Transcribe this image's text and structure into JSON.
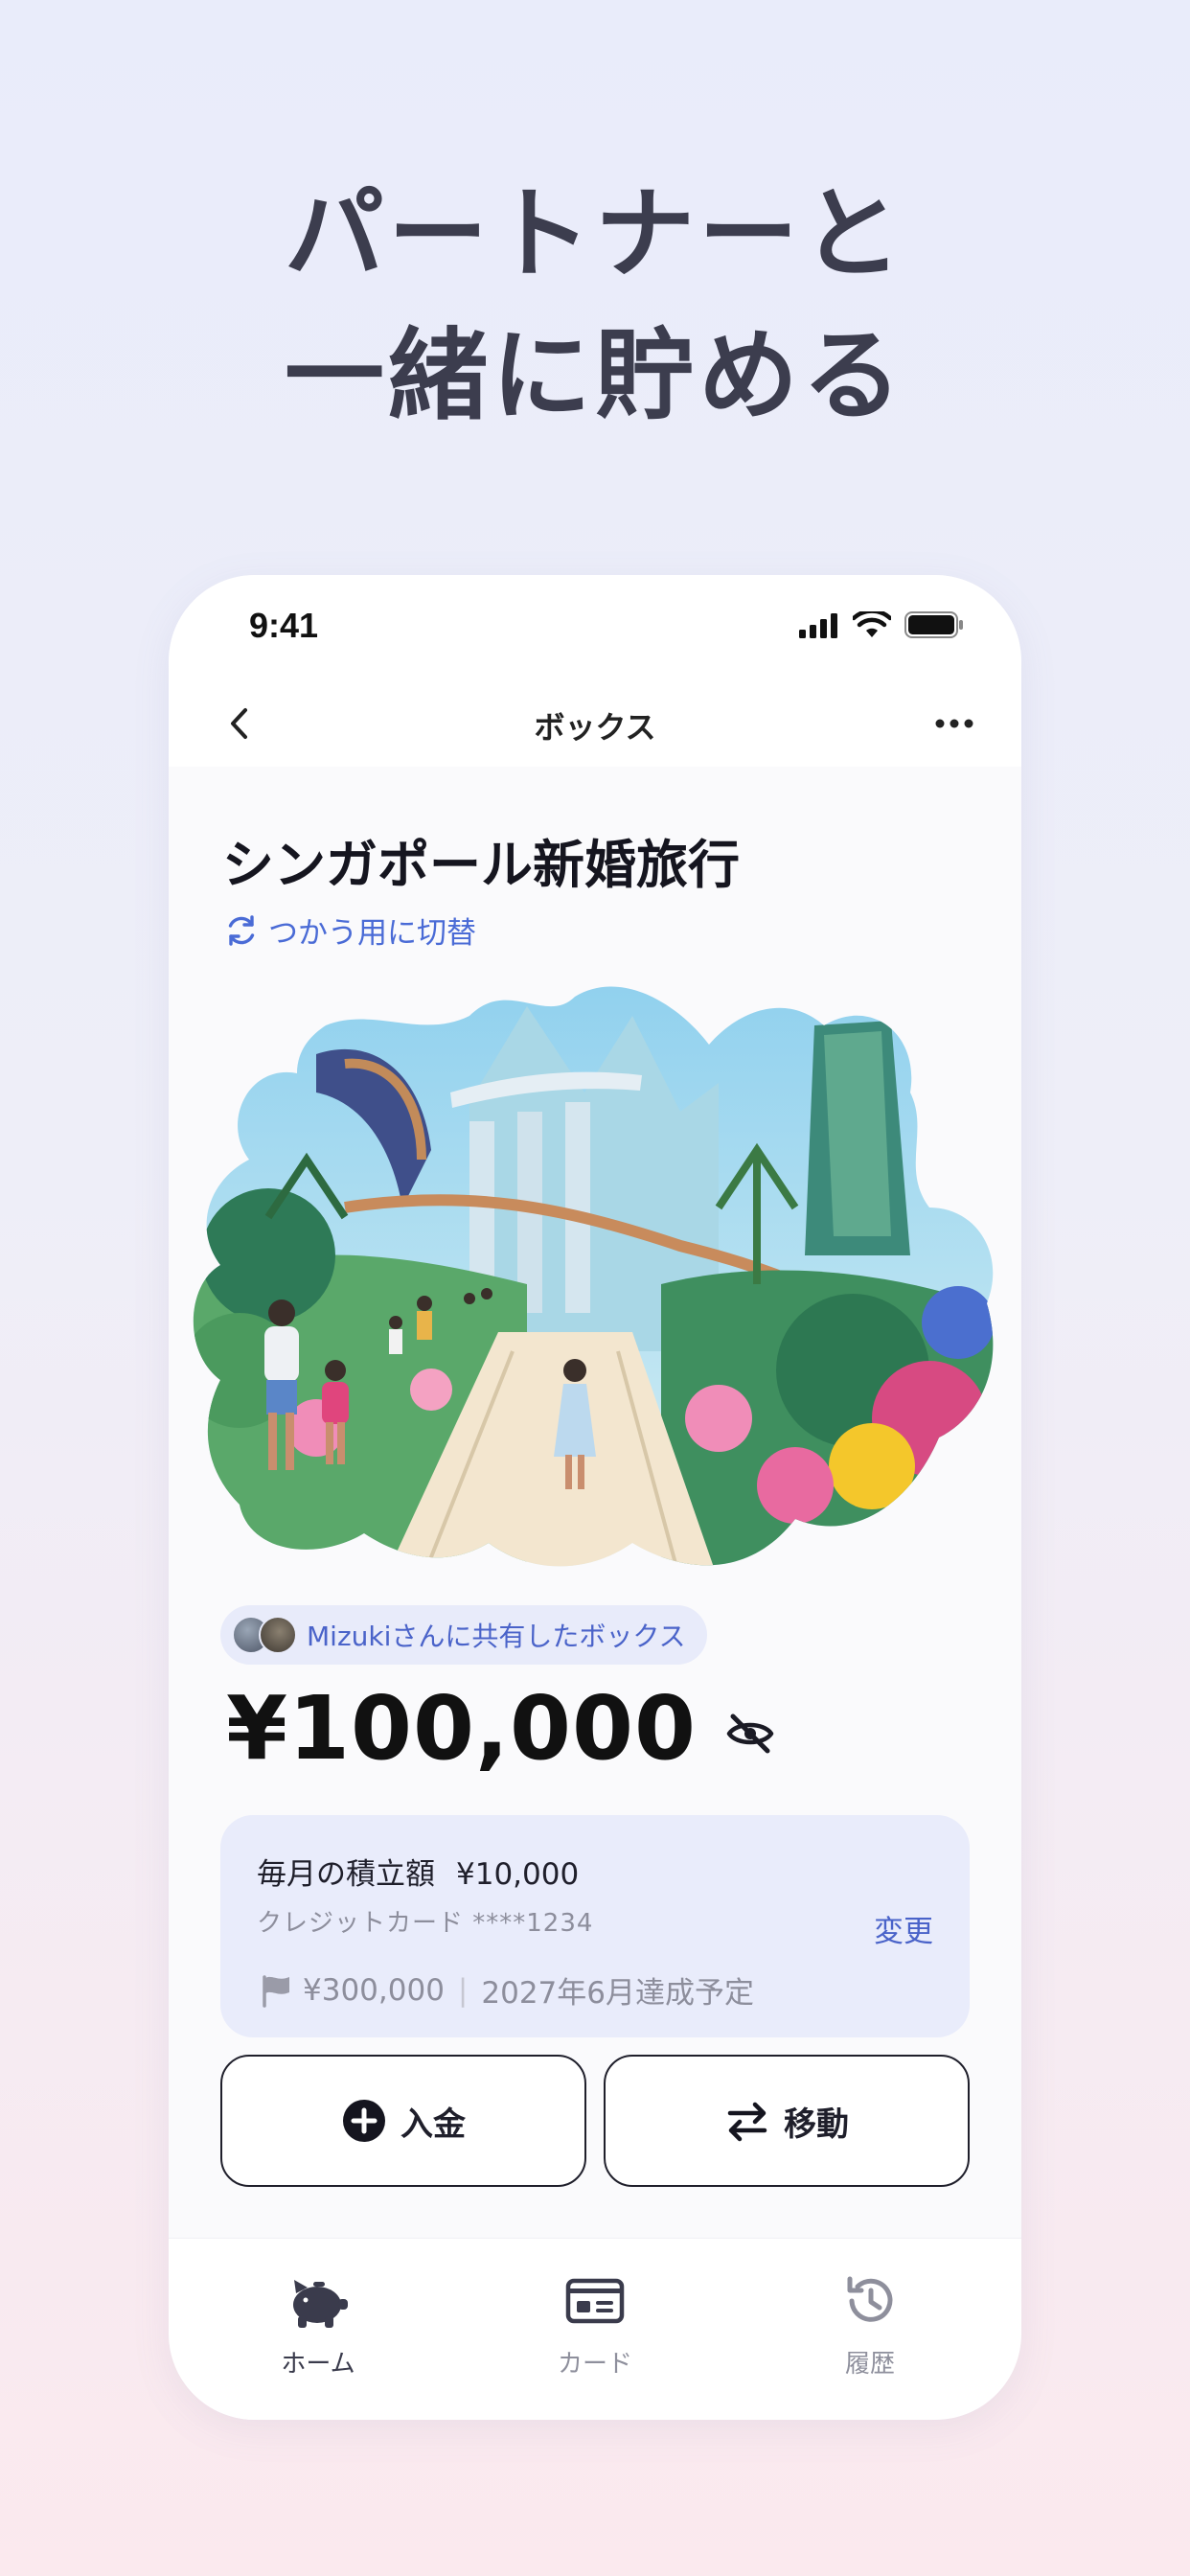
{
  "headline": {
    "line1": "パートナーと",
    "line2": "一緒に貯める"
  },
  "status_bar": {
    "time": "9:41"
  },
  "nav": {
    "title": "ボックス"
  },
  "box": {
    "title": "シンガポール新婚旅行",
    "switch_label": "つかう用に切替",
    "shared_label": "Mizukiさんに共有したボックス",
    "balance": "¥100,000"
  },
  "plan": {
    "monthly_label": "毎月の積立額",
    "monthly_amount": "¥10,000",
    "payment_method": "クレジットカード ****1234",
    "change_label": "変更",
    "goal_amount": "¥300,000",
    "goal_date": "2027年6月達成予定"
  },
  "actions": {
    "deposit": "入金",
    "move": "移動"
  },
  "tabs": [
    {
      "label": "ホーム",
      "icon": "piggy-bank-icon",
      "active": true
    },
    {
      "label": "カード",
      "icon": "card-icon",
      "active": false
    },
    {
      "label": "履歴",
      "icon": "history-icon",
      "active": false
    }
  ],
  "colors": {
    "accent": "#4a63c9",
    "card_bg": "#e9ecfb",
    "text": "#1f1f2b"
  }
}
